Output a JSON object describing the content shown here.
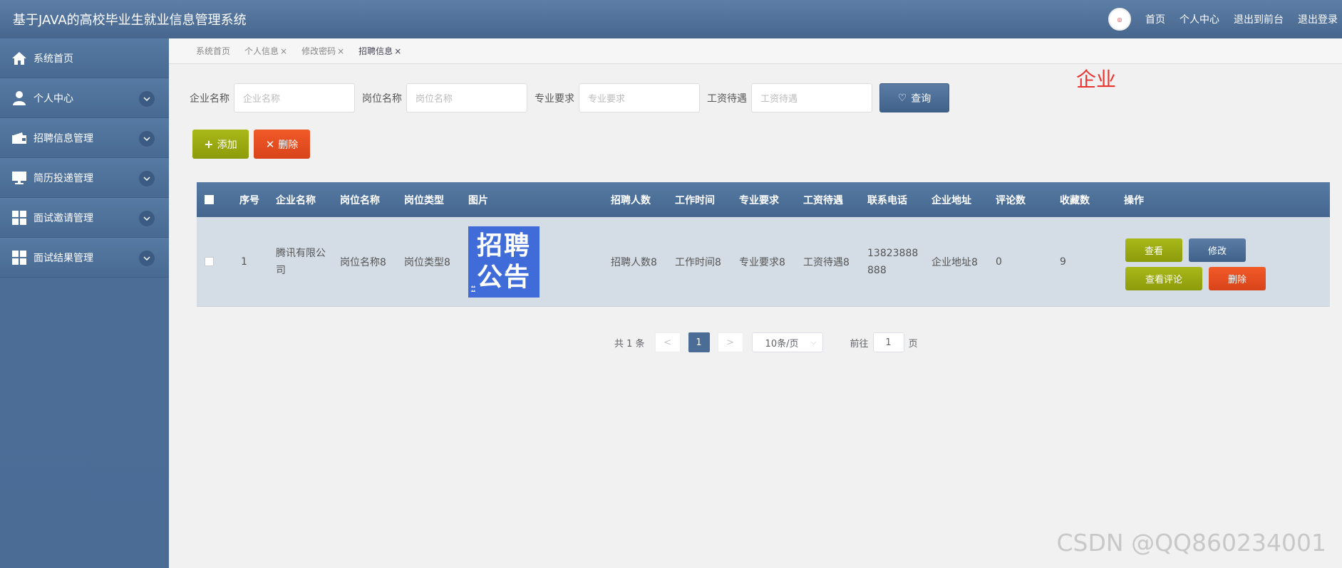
{
  "header": {
    "title": "基于JAVA的高校毕业生就业信息管理系统",
    "links": [
      "首页",
      "个人中心",
      "退出到前台",
      "退出登录"
    ]
  },
  "sidebar": {
    "items": [
      {
        "label": "系统首页",
        "icon": "home-icon",
        "expandable": false
      },
      {
        "label": "个人中心",
        "icon": "user-icon",
        "expandable": true
      },
      {
        "label": "招聘信息管理",
        "icon": "wallet-icon",
        "expandable": true
      },
      {
        "label": "简历投递管理",
        "icon": "monitor-icon",
        "expandable": true
      },
      {
        "label": "面试邀请管理",
        "icon": "grid-icon",
        "expandable": true
      },
      {
        "label": "面试结果管理",
        "icon": "grid-icon",
        "expandable": true
      }
    ]
  },
  "tabs": [
    {
      "label": "系统首页",
      "closable": false
    },
    {
      "label": "个人信息",
      "closable": true
    },
    {
      "label": "修改密码",
      "closable": true
    },
    {
      "label": "招聘信息",
      "closable": true,
      "active": true
    }
  ],
  "annotation": "企业",
  "search": {
    "fields": [
      {
        "label": "企业名称",
        "placeholder": "企业名称"
      },
      {
        "label": "岗位名称",
        "placeholder": "岗位名称"
      },
      {
        "label": "专业要求",
        "placeholder": "专业要求"
      },
      {
        "label": "工资待遇",
        "placeholder": "工资待遇"
      }
    ],
    "query_label": "查询"
  },
  "actions": {
    "add_label": "添加",
    "delete_label": "删除"
  },
  "table": {
    "columns": [
      "序号",
      "企业名称",
      "岗位名称",
      "岗位类型",
      "图片",
      "招聘人数",
      "工作时间",
      "专业要求",
      "工资待遇",
      "联系电话",
      "企业地址",
      "评论数",
      "收藏数",
      "操作"
    ],
    "rows": [
      {
        "index": "1",
        "company_line1": "腾讯有限公",
        "company_line2": "司",
        "job_name": "岗位名称8",
        "job_type": "岗位类型8",
        "poster_line1": "招聘",
        "poster_line2": "公告",
        "headcount": "招聘人数8",
        "work_time": "工作时间8",
        "major": "专业要求8",
        "salary": "工资待遇8",
        "phone_line1": "13823888",
        "phone_line2": "888",
        "address": "企业地址8",
        "comments": "0",
        "favorites": "9",
        "ops": {
          "view": "查看",
          "edit": "修改",
          "comments": "查看评论",
          "delete": "删除"
        }
      }
    ]
  },
  "pagination": {
    "total": "共 1 条",
    "prev": "<",
    "page": "1",
    "next": ">",
    "page_size": "10条/页",
    "goto_label": "前往",
    "goto_value": "1",
    "page_suffix": "页"
  },
  "watermark": "CSDN @QQ860234001",
  "colors": {
    "header": "#4f719a",
    "sidebar": "#4a6c95",
    "add": "#9aaa12",
    "delete": "#e54d22",
    "annotation": "#e8352f"
  }
}
